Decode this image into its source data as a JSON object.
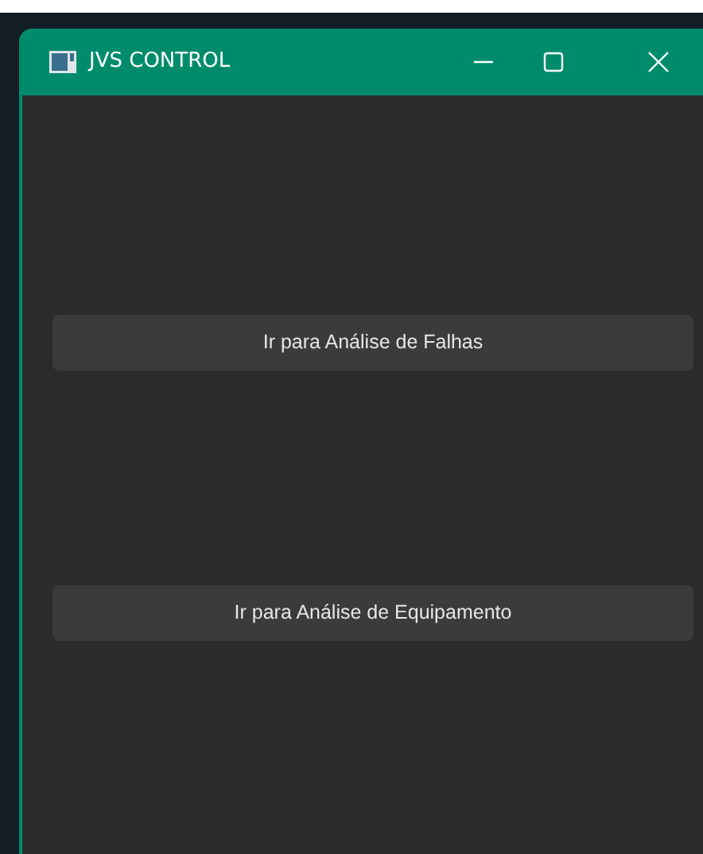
{
  "window": {
    "title": "JVS CONTROL"
  },
  "buttons": [
    {
      "label": "Ir para Análise de Falhas"
    },
    {
      "label": "Ir para Análise de Equipamento"
    }
  ]
}
